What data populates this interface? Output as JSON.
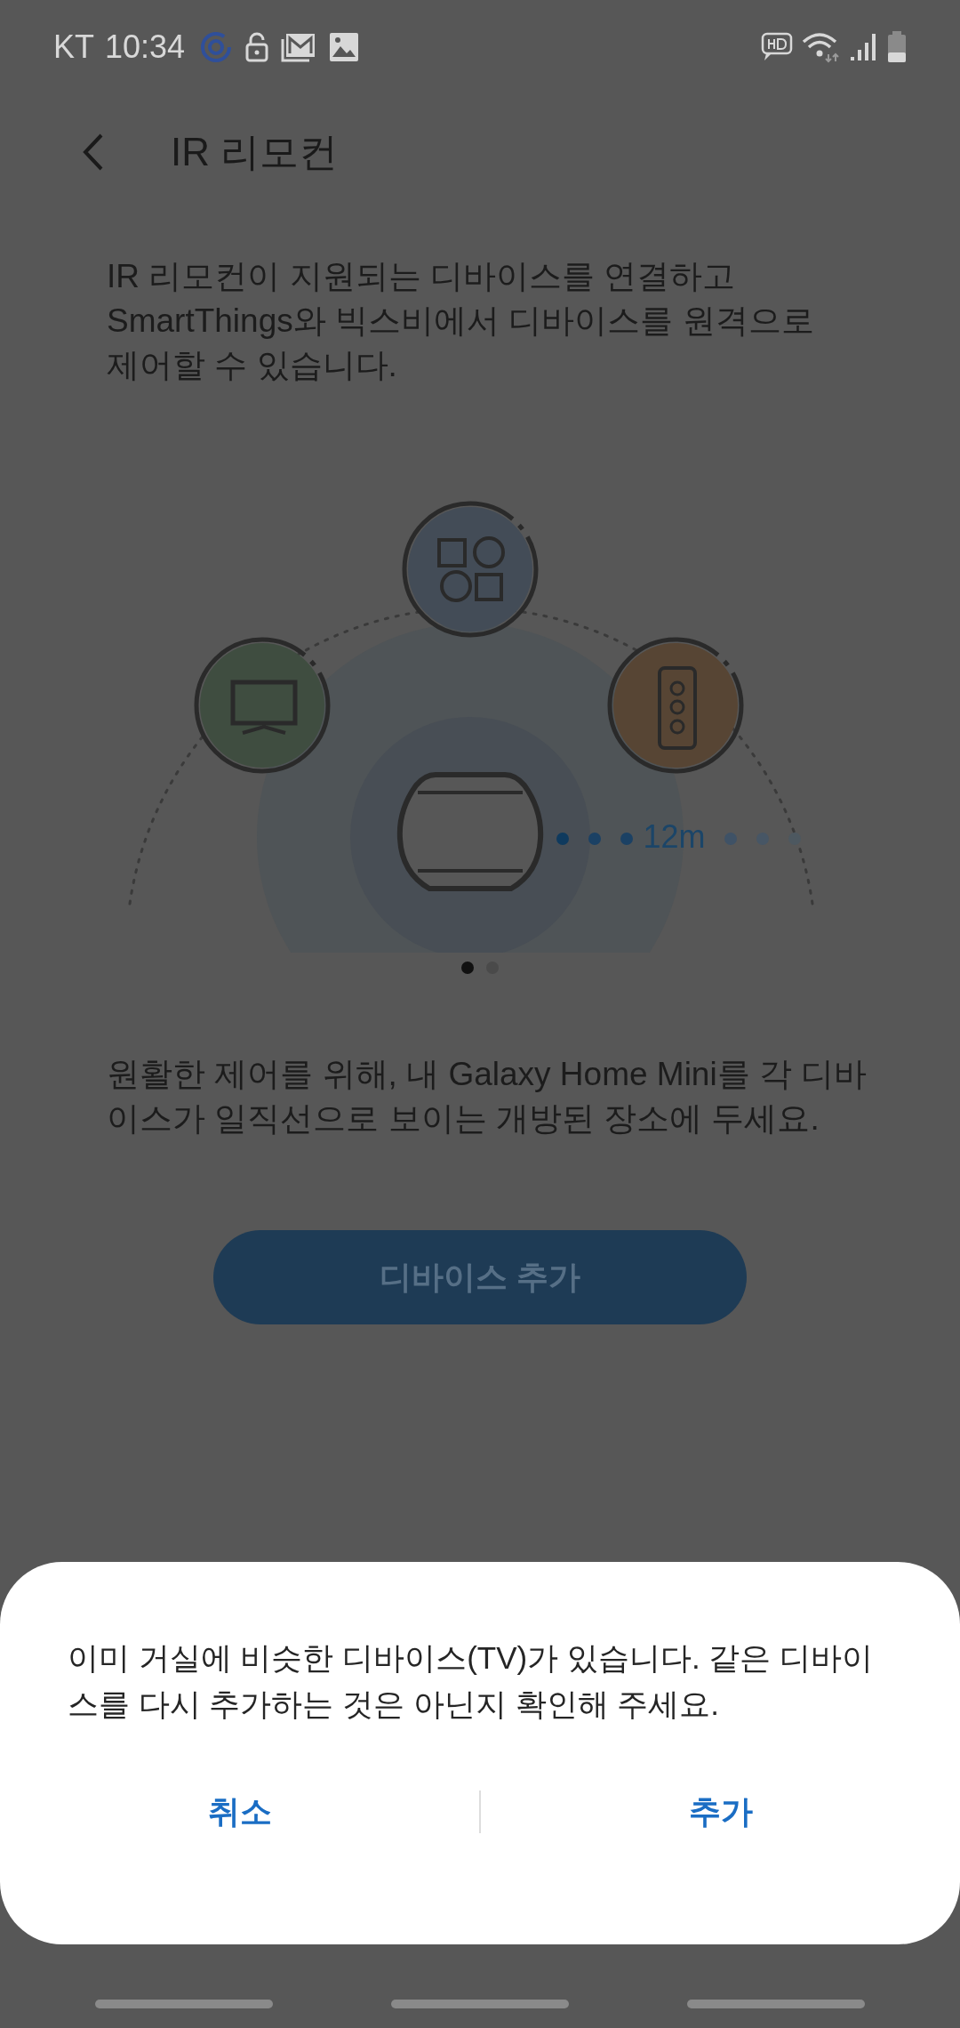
{
  "status_bar": {
    "carrier": "KT",
    "time": "10:34"
  },
  "header": {
    "title": "IR 리모컨"
  },
  "description": "IR 리모컨이 지원되는 디바이스를 연결하고 SmartThings와 빅스비에서 디바이스를 원격으로 제어할 수 있습니다.",
  "illustration": {
    "distance": "12m"
  },
  "pages": [
    {
      "selected": true
    },
    {
      "selected": false
    }
  ],
  "hint": "원활한 제어를 위해, 내 Galaxy Home Mini를 각 디바이스가 일직선으로 보이는 개방된 장소에 두세요.",
  "add_button": {
    "label": "디바이스 추가"
  },
  "dialog": {
    "message": "이미 거실에 비슷한 디바이스(TV)가 있습니다. 같은 디바이스를 다시 추가하는 것은 아닌지 확인해 주세요.",
    "buttons": [
      "취소",
      "추가"
    ]
  }
}
